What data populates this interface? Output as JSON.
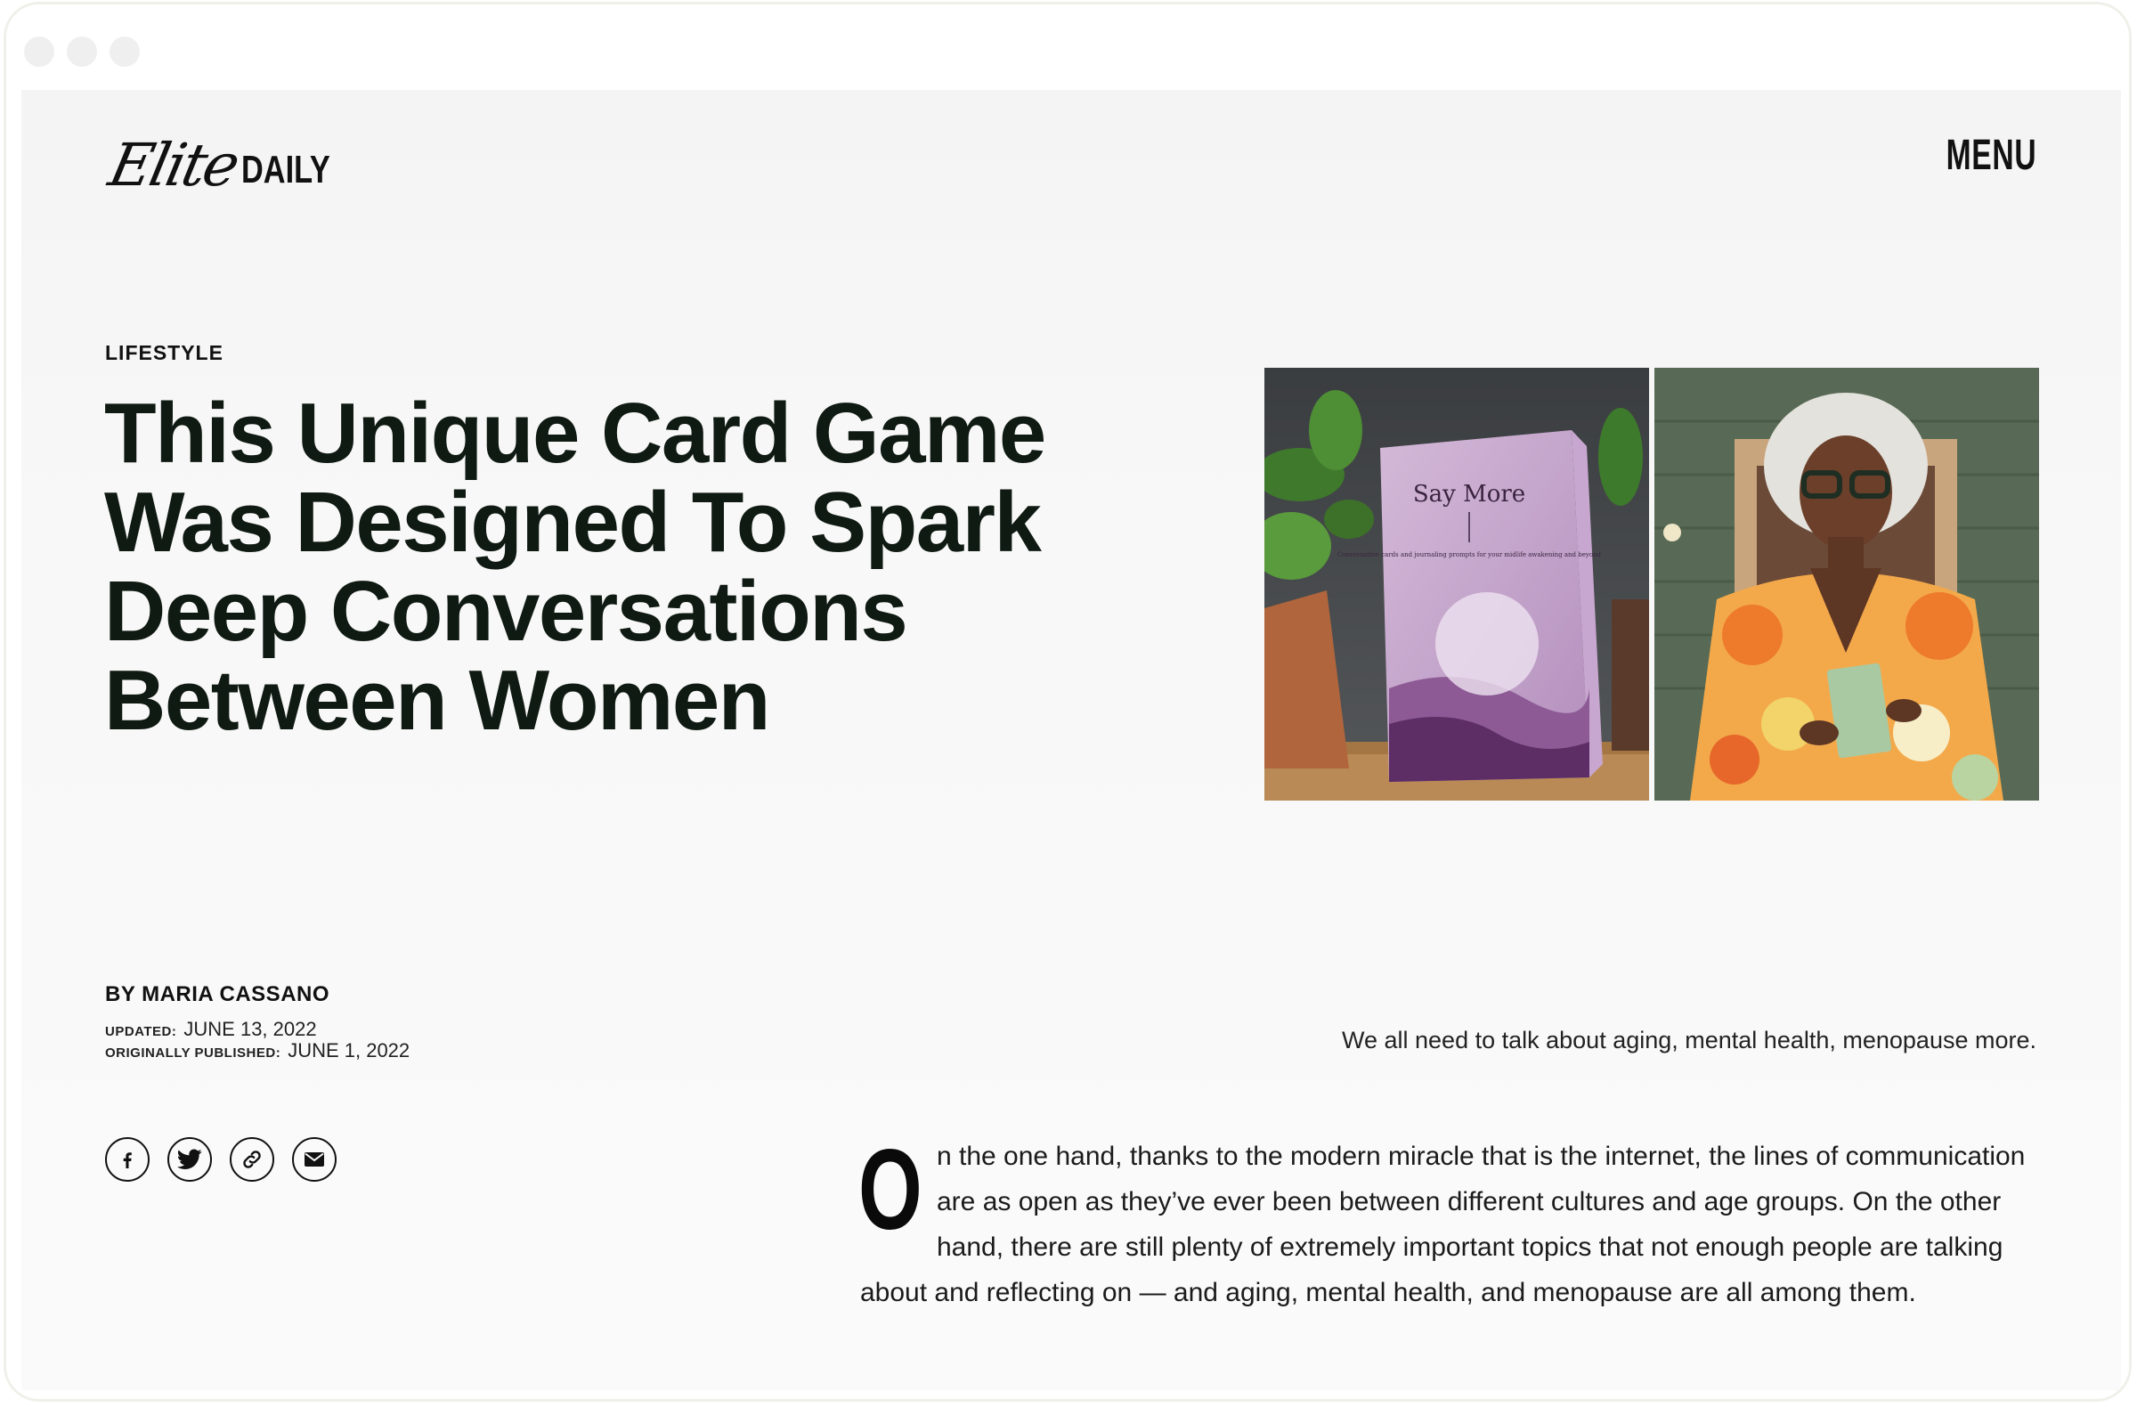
{
  "site": {
    "logo_script": "Elite",
    "logo_word": "DAILY",
    "menu_label": "MENU"
  },
  "article": {
    "category": "LIFESTYLE",
    "headline": "This Unique Card Game Was Designed To Spark Deep Conversations Between Women",
    "byline": "BY MARIA CASSANO",
    "updated_label": "UPDATED:",
    "updated_date": "JUNE 13, 2022",
    "published_label": "ORIGINALLY PUBLISHED:",
    "published_date": "JUNE 1, 2022",
    "caption": "We all need to talk about aging, mental health, menopause more.",
    "dropcap": "O",
    "body": "n the one hand, thanks to the modern miracle that is the internet, the lines of communication are as open as they’ve ever been between different cultures and age groups. On the other hand, there are still plenty of extremely important topics that not enough people are talking about and reflecting on — and aging, mental health, and menopause are all among them."
  },
  "hero": {
    "box_title": "Say More",
    "box_subtitle": "Conversation cards and journaling prompts for your midlife awakening and beyond"
  },
  "share_icons": [
    "facebook-icon",
    "twitter-icon",
    "link-icon",
    "email-icon"
  ]
}
